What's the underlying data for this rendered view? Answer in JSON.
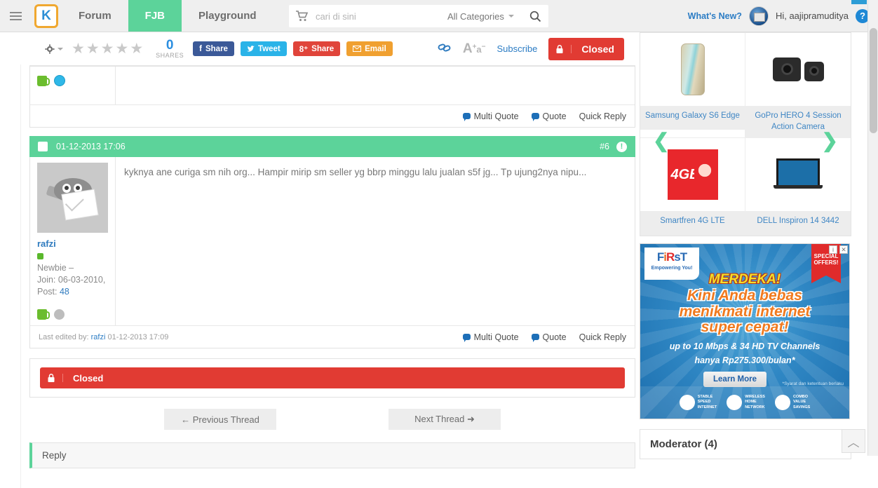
{
  "topnav": {
    "menu_icon": "hamburger-icon",
    "logo_text": "K",
    "links": [
      {
        "label": "Forum",
        "active": false
      },
      {
        "label": "FJB",
        "active": true
      },
      {
        "label": "Playground",
        "active": false
      }
    ],
    "search": {
      "cart_icon": "cart-icon",
      "placeholder": "cari di sini",
      "value": "",
      "category_label": "All Categories",
      "search_icon": "search-icon"
    },
    "whats_new": "What's New?",
    "greeting": "Hi, aajipramuditya",
    "help_icon": "question-mark-icon",
    "accent_green": "#5cd39a",
    "accent_blue": "#2b7cc4"
  },
  "toolbar": {
    "gear_icon": "gear-icon",
    "rating_stars": 5,
    "rating_filled": 0,
    "shares_count": "0",
    "shares_label": "SHARES",
    "share_buttons": [
      {
        "label": "Share",
        "network": "facebook",
        "icon": "facebook-icon",
        "color": "#3b5998"
      },
      {
        "label": "Tweet",
        "network": "twitter",
        "icon": "twitter-icon",
        "color": "#2ab3e8"
      },
      {
        "label": "Share",
        "network": "googleplus",
        "icon": "google-plus-icon",
        "color": "#e0443a"
      },
      {
        "label": "Email",
        "network": "email",
        "icon": "envelope-icon",
        "color": "#f0a030"
      }
    ],
    "link_icon": "chain-link-icon",
    "fontsize_icon": "font-size-icon",
    "subscribe_label": "Subscribe",
    "closed_label": "Closed",
    "closed_lock_icon": "lock-icon",
    "closed_color": "#e13b33"
  },
  "post_partial": {
    "icons": [
      "mug-icon",
      "smiley-blue-icon"
    ],
    "footer": {
      "multi_quote": "Multi Quote",
      "quote": "Quote",
      "quick_reply": "Quick Reply"
    }
  },
  "post": {
    "header": {
      "checkbox_name": "post-select-checkbox",
      "timestamp": "01-12-2013 17:06",
      "post_number": "#6",
      "report_icon": "report-icon"
    },
    "user": {
      "avatar_icon": "default-avatar-icon",
      "username": "rafzi",
      "online_status_color": "#5ab82c",
      "rank": "Newbie –",
      "join": "Join: 06-03-2010,",
      "post_label": "Post:",
      "post_count": "48",
      "badges": [
        "mug-icon",
        "smiley-gray-icon"
      ]
    },
    "body": "kyknya ane curiga sm nih org... Hampir mirip sm seller yg bbrp minggu lalu jualan s5f jg... Tp ujung2nya nipu...",
    "footer": {
      "last_edited_prefix": "Last edited by:",
      "last_edited_user": "rafzi",
      "last_edited_time": "01-12-2013 17:09",
      "multi_quote": "Multi Quote",
      "quote": "Quote",
      "quick_reply": "Quick Reply"
    }
  },
  "closed_panel": {
    "label": "Closed",
    "lock_icon": "lock-icon"
  },
  "thread_nav": {
    "previous": "Previous Thread",
    "next": "Next Thread",
    "prev_icon": "arrow-left-icon",
    "next_icon": "arrow-right-icon"
  },
  "reply_section": {
    "title": "Reply"
  },
  "sidebar": {
    "products": [
      {
        "name": "Samsung Galaxy S6 Edge",
        "image": "phone-image"
      },
      {
        "name": "GoPro HERO 4 Session Action Camera",
        "image": "gopro-image"
      },
      {
        "name": "Smartfren 4G LTE",
        "image": "smartfren-ad-image"
      },
      {
        "name": "DELL Inspiron 14 3442",
        "image": "laptop-image"
      }
    ],
    "carousel": {
      "prev_icon": "chevron-left-icon",
      "next_icon": "chevron-right-icon"
    },
    "ad": {
      "brand": "FiRsT",
      "brand_sub": "Empowering You!",
      "badge": "SPECIAL OFFERS!",
      "headline": "MERDEKA!",
      "line1": "Kini Anda bebas",
      "line2": "menikmati internet",
      "line3": "super cepat!",
      "detail1": "up to 10 Mbps & 34 HD TV Channels",
      "detail2": "hanya Rp275.300/bulan*",
      "cta": "Learn More",
      "tnc": "*Syarat dan ketentuan berlaku",
      "features": [
        {
          "line1": "STABLE",
          "line2": "SPEED",
          "line3": "INTERNET"
        },
        {
          "line1": "WIRELESS",
          "line2": "HOME",
          "line3": "NETWORK"
        },
        {
          "line1": "COMBO",
          "line2": "VALUE",
          "line3": "SAVINGS"
        }
      ],
      "info_icon": "ad-info-icon",
      "close_icon": "ad-close-icon"
    },
    "moderator": {
      "title": "Moderator (4)",
      "collapse_icon": "chevron-up-icon"
    }
  },
  "scroll": {
    "go_top_icon": "chevron-up-icon"
  }
}
